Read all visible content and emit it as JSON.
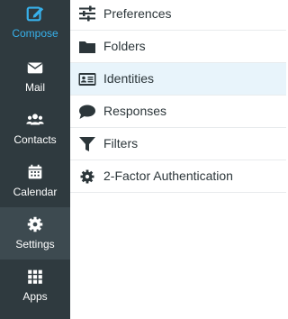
{
  "sidebar": {
    "items": [
      {
        "label": "Compose",
        "icon": "compose-icon"
      },
      {
        "label": "Mail",
        "icon": "envelope-icon"
      },
      {
        "label": "Contacts",
        "icon": "users-icon"
      },
      {
        "label": "Calendar",
        "icon": "calendar-icon"
      },
      {
        "label": "Settings",
        "icon": "gear-icon"
      },
      {
        "label": "Apps",
        "icon": "grid-icon"
      }
    ],
    "selected": "Settings",
    "colors": {
      "background": "#2f3a3f",
      "accent": "#37b0ea",
      "selected": "#3d4a50"
    }
  },
  "settings_menu": {
    "items": [
      {
        "label": "Preferences",
        "icon": "sliders-icon"
      },
      {
        "label": "Folders",
        "icon": "folder-icon"
      },
      {
        "label": "Identities",
        "icon": "id-card-icon"
      },
      {
        "label": "Responses",
        "icon": "speech-bubble-icon"
      },
      {
        "label": "Filters",
        "icon": "filter-icon"
      },
      {
        "label": "2-Factor Authentication",
        "icon": "gear-icon"
      }
    ],
    "selected": "Identities",
    "colors": {
      "selected_row": "#e8f4fb",
      "text": "#2c363a"
    }
  }
}
